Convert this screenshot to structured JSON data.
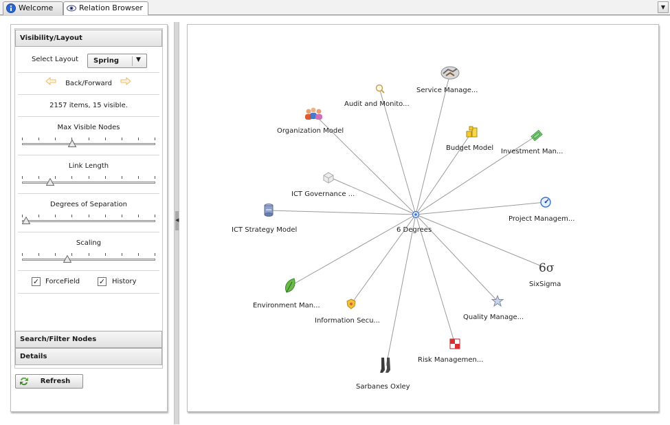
{
  "tabs": {
    "welcome": "Welcome",
    "relation_browser": "Relation Browser"
  },
  "panel": {
    "visibility_title": "Visibility/Layout",
    "select_layout_label": "Select Layout",
    "layout_value": "Spring",
    "back_forward_label": "Back/Forward",
    "items_status": "2157 items, 15 visible.",
    "sliders": {
      "max_visible_nodes": {
        "label": "Max Visible Nodes",
        "position": 0.37
      },
      "link_length": {
        "label": "Link Length",
        "position": 0.19
      },
      "degrees_of_separation": {
        "label": "Degrees of Separation",
        "position": 0.0
      },
      "scaling": {
        "label": "Scaling",
        "position": 0.33
      }
    },
    "checkboxes": {
      "forcefield": {
        "label": "ForceField",
        "checked": true
      },
      "history": {
        "label": "History",
        "checked": true
      }
    },
    "search_filter_title": "Search/Filter Nodes",
    "details_title": "Details",
    "refresh_label": "Refresh"
  },
  "graph": {
    "center": {
      "label": "6 Degrees",
      "icon": "hub-icon"
    },
    "nodes": [
      {
        "id": "service-management",
        "label": "Service Manage...",
        "icon": "handshake-icon"
      },
      {
        "id": "audit-monitoring",
        "label": "Audit and Monito...",
        "icon": "magnifier-icon"
      },
      {
        "id": "organization-model",
        "label": "Organization Model",
        "icon": "people-icon"
      },
      {
        "id": "budget-model",
        "label": "Budget Model",
        "icon": "coins-icon"
      },
      {
        "id": "investment-management",
        "label": "Investment Man...",
        "icon": "money-icon"
      },
      {
        "id": "ict-governance",
        "label": "ICT Governance ...",
        "icon": "cubes-icon"
      },
      {
        "id": "project-management",
        "label": "Project Managem...",
        "icon": "gauge-icon"
      },
      {
        "id": "ict-strategy-model",
        "label": "ICT Strategy Model",
        "icon": "server-icon"
      },
      {
        "id": "sixsigma",
        "label": "SixSigma",
        "icon": "sixsigma-icon"
      },
      {
        "id": "environment-management",
        "label": "Environment Man...",
        "icon": "leaf-icon"
      },
      {
        "id": "information-security",
        "label": "Information Secu...",
        "icon": "shield-icon"
      },
      {
        "id": "quality-management",
        "label": "Quality Manage...",
        "icon": "award-icon"
      },
      {
        "id": "risk-management",
        "label": "Risk Managemen...",
        "icon": "checker-icon"
      },
      {
        "id": "sarbanes-oxley",
        "label": "Sarbanes Oxley",
        "icon": "boots-icon"
      }
    ]
  },
  "colors": {
    "edge": "#9a9a9a",
    "hub": "#3a6fd8",
    "arrow": "#f0c070"
  }
}
